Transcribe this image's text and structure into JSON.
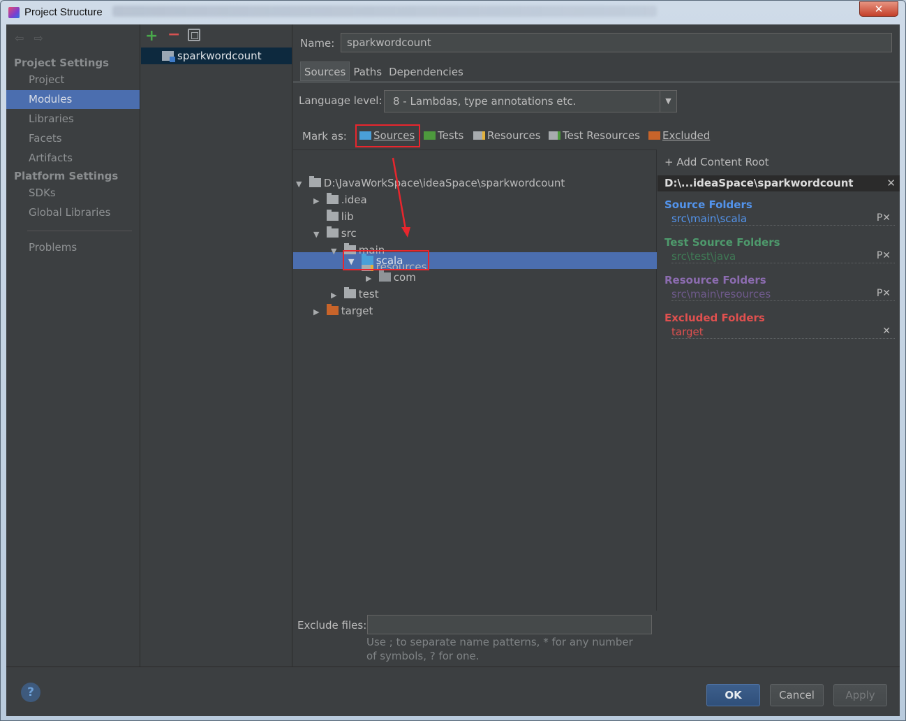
{
  "window": {
    "title": "Project Structure"
  },
  "sidebar": {
    "project_settings_header": "Project Settings",
    "project_items": [
      {
        "label": "Project"
      },
      {
        "label": "Modules"
      },
      {
        "label": "Libraries"
      },
      {
        "label": "Facets"
      },
      {
        "label": "Artifacts"
      }
    ],
    "selected_item": "Modules",
    "platform_settings_header": "Platform Settings",
    "platform_items": [
      {
        "label": "SDKs"
      },
      {
        "label": "Global Libraries"
      }
    ],
    "problems_label": "Problems"
  },
  "modules": {
    "items": [
      {
        "label": "sparkwordcount"
      }
    ]
  },
  "main": {
    "name_label": "Name:",
    "name_value": "sparkwordcount",
    "tabs": [
      {
        "label": "Sources"
      },
      {
        "label": "Paths"
      },
      {
        "label": "Dependencies"
      }
    ],
    "active_tab": "Sources",
    "language_level_label": "Language level:",
    "language_level_value": "8 - Lambdas, type annotations etc.",
    "mark_as_label": "Mark as:",
    "mark_as": [
      {
        "label": "Sources",
        "color": "#4a9fd8"
      },
      {
        "label": "Tests",
        "color": "#4d9a3d"
      },
      {
        "label": "Resources",
        "color": "#a7abae"
      },
      {
        "label": "Test Resources",
        "color": "#a7abae"
      },
      {
        "label": "Excluded",
        "color": "#c8642a"
      }
    ],
    "tree": {
      "root": "D:\\JavaWorkSpace\\ideaSpace\\sparkwordcount",
      "idea": ".idea",
      "lib": "lib",
      "src": "src",
      "main": "main",
      "resources": "resources",
      "scala": "scala",
      "com": "com",
      "test": "test",
      "target": "target"
    },
    "exclude_files_label": "Exclude files:",
    "exclude_files_value": "",
    "exclude_files_hint": "Use ; to separate name patterns, * for any number of symbols, ? for one."
  },
  "content_root": {
    "add_label": "+ Add Content Root",
    "root_path": "D:\\...ideaSpace\\sparkwordcount",
    "source_folders": {
      "header": "Source Folders",
      "color": "#5394ec",
      "paths": [
        "src\\main\\scala"
      ]
    },
    "test_source_folders": {
      "header": "Test Source Folders",
      "color": "#4e9a6c",
      "paths": [
        "src\\test\\java"
      ]
    },
    "resource_folders": {
      "header": "Resource Folders",
      "color": "#8c6cb0",
      "paths": [
        "src\\main\\resources"
      ]
    },
    "excluded_folders": {
      "header": "Excluded Folders",
      "color": "#e0504f",
      "paths": [
        "target"
      ]
    }
  },
  "footer": {
    "help_label": "?",
    "ok_label": "OK",
    "cancel_label": "Cancel",
    "apply_label": "Apply"
  }
}
